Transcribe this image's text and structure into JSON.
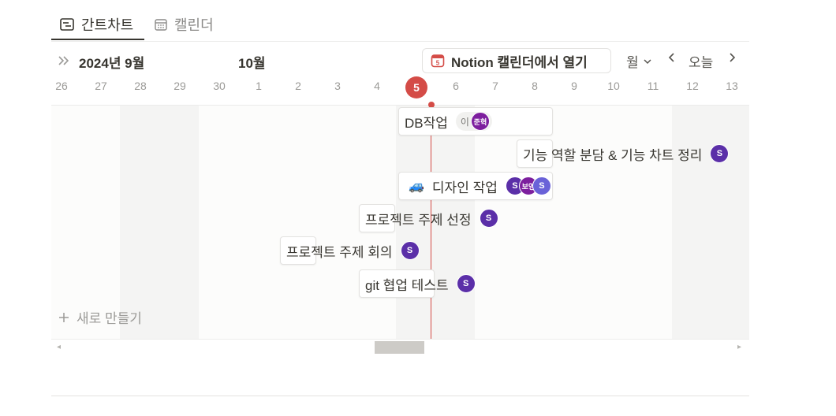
{
  "tabs": [
    {
      "label": "간트차트",
      "icon": "gantt-icon",
      "active": true
    },
    {
      "label": "캘린더",
      "icon": "calendar-icon",
      "active": false
    }
  ],
  "toolbar": {
    "expand_icon": "double-chevron-right-icon",
    "current_month": "2024년 9월",
    "next_month": "10월",
    "open_in_notion": "Notion 캘린더에서 열기",
    "view_mode": "월",
    "today": "오늘"
  },
  "days": [
    "26",
    "27",
    "28",
    "29",
    "30",
    "1",
    "2",
    "3",
    "4",
    "5",
    "6",
    "7",
    "8",
    "9",
    "10",
    "11",
    "12",
    "13"
  ],
  "today_day": "5",
  "colors": {
    "today": "#d44c47",
    "weekend": "#f4f4f3",
    "avatar_purple": "#5b2fa8"
  },
  "tasks": [
    {
      "title": "DB작업",
      "assignees": [
        {
          "chip": "이",
          "avatar": "준혁"
        }
      ]
    },
    {
      "title": "기능 역할 분담 & 기능 차트 정리",
      "assignees": [
        {
          "avatar": "S"
        }
      ]
    },
    {
      "title": "디자인 작업",
      "emoji": "🚙",
      "assignees": [
        {
          "avatar": "S"
        },
        {
          "avatar": "보영"
        },
        {
          "avatar": "S"
        }
      ]
    },
    {
      "title": "프로젝트 주제 선정",
      "assignees": [
        {
          "avatar": "S"
        }
      ]
    },
    {
      "title": "프로젝트 주제 회의",
      "assignees": [
        {
          "avatar": "S"
        }
      ]
    },
    {
      "title": "git 협업 테스트",
      "assignees": [
        {
          "avatar": "S"
        }
      ]
    }
  ],
  "new_item": "새로 만들기"
}
